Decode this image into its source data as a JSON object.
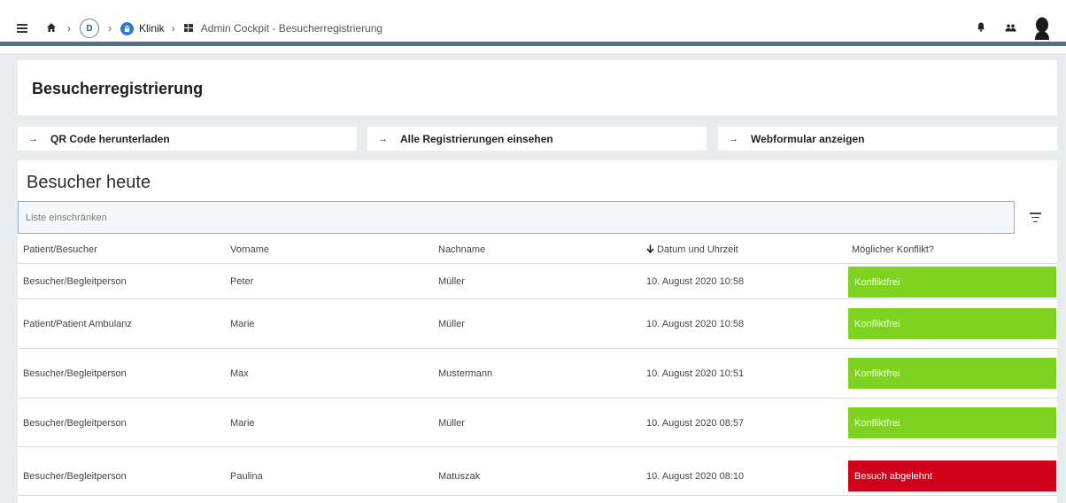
{
  "breadcrumb": {
    "org_initial": "D",
    "clinic": "Klinik",
    "current": "Admin Cockpit - Besucherregistrierung"
  },
  "page": {
    "title": "Besucherregistrierung"
  },
  "actions": [
    {
      "label": "QR Code herunterladen"
    },
    {
      "label": "Alle Registrierungen einsehen"
    },
    {
      "label": "Webformular anzeigen"
    }
  ],
  "list": {
    "title": "Besucher heute",
    "filter_placeholder": "Liste einschränken",
    "columns": [
      "Patient/Besucher",
      "Vorname",
      "Nachname",
      "Datum und Uhrzeit",
      "Möglicher Konflikt?"
    ],
    "rows": [
      {
        "type": "Besucher/Begleitperson",
        "first": "Peter",
        "last": "Müller",
        "datetime": "10. August 2020 10:58",
        "status": "Konfliktfrei",
        "status_color": "#7ed321"
      },
      {
        "type": "Patient/Patient Ambulanz",
        "first": "Marie",
        "last": "Müller",
        "datetime": "10. August 2020 10:58",
        "status": "Konfliktfrei",
        "status_color": "#7ed321"
      },
      {
        "type": "Besucher/Begleitperson",
        "first": "Max",
        "last": "Mustermann",
        "datetime": "10. August 2020 10:51",
        "status": "Konfliktfrei",
        "status_color": "#7ed321"
      },
      {
        "type": "Besucher/Begleitperson",
        "first": "Marie",
        "last": "Müller",
        "datetime": "10. August 2020 08:57",
        "status": "Konfliktfrei",
        "status_color": "#7ed321"
      },
      {
        "type": "Besucher/Begleitperson",
        "first": "Paulina",
        "last": "Matuszak",
        "datetime": "10. August 2020 08:10",
        "status": "Besuch abgelehnt",
        "status_color": "#d0021b"
      }
    ]
  },
  "colors": {
    "accent_bar": "#4f6f8f",
    "ok": "#7ed321",
    "rejected": "#d0021b",
    "lock_badge": "#2a7bd8"
  },
  "icons": [
    "menu-icon",
    "home-icon",
    "chevron-right-icon",
    "lock-icon",
    "grid-icon",
    "bell-icon",
    "people-icon",
    "avatar-icon",
    "arrow-right-icon",
    "sort-arrow-down-icon",
    "filter-icon"
  ]
}
